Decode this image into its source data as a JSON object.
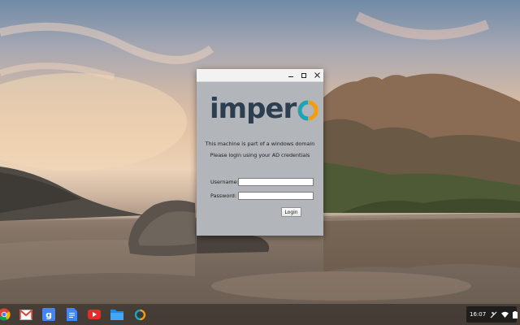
{
  "dialog": {
    "logo_text": "imper",
    "message_line1": "This machine is part of a windows domain",
    "message_line2": "Please login using your AD credentials",
    "username_label": "Username:",
    "password_label": "Password:",
    "username_value": "",
    "password_value": "",
    "login_label": "Login"
  },
  "shelf": {
    "apps": [
      "chrome-icon",
      "gmail-icon",
      "google-search-icon",
      "docs-icon",
      "youtube-icon",
      "files-icon",
      "impero-app-icon"
    ],
    "clock": "16:07"
  },
  "colors": {
    "logo_dark": "#2c3e50",
    "logo_teal": "#1fa3b3",
    "logo_orange": "#f39c12",
    "dialog_bg": "#b2b5b9"
  }
}
